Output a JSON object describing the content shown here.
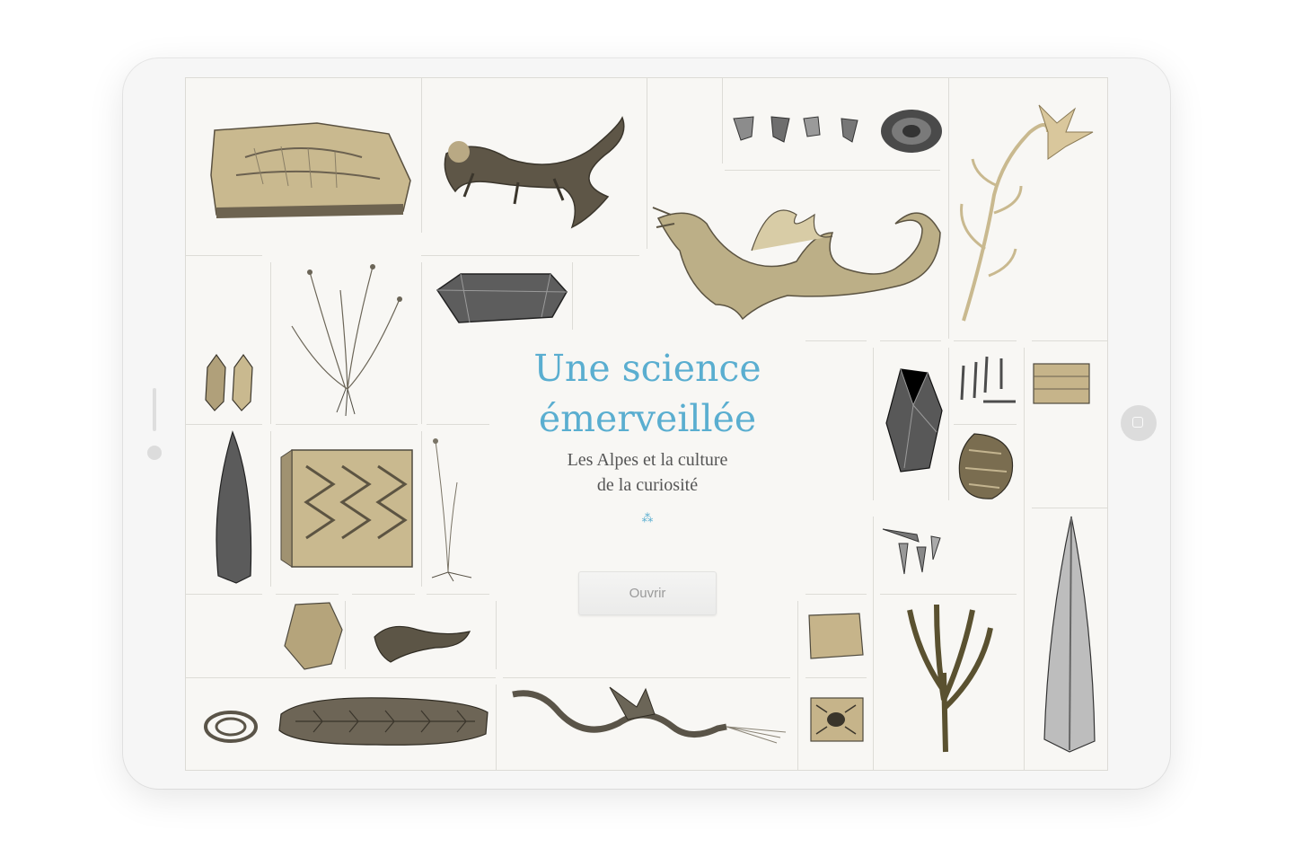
{
  "cover": {
    "title_line1": "Une science",
    "title_line2": "émerveillée",
    "subtitle_line1": "Les Alpes et la culture",
    "subtitle_line2": "de la curiosité",
    "asterism": "⁂",
    "open_button_label": "Ouvrir"
  },
  "colors": {
    "accent": "#5aaed0",
    "engraving_sepia": "#c3b48f",
    "engraving_dark": "#4f4a3e",
    "background": "#f8f7f4"
  },
  "illustrations": [
    "fossil-fish-slab",
    "salamander",
    "crystal-fragments",
    "ammonite",
    "dragon",
    "flowering-plant",
    "grass-plant",
    "quartz-crystal",
    "twin-crystals",
    "belemnite",
    "wood-grain-cube",
    "small-grass",
    "smoky-quartz",
    "nails",
    "wooden-chest",
    "coral-mineral",
    "cone-shells",
    "long-shell",
    "rock-stone",
    "lizard",
    "stone-slab",
    "fern-plant",
    "insect-fossil",
    "coiled-snake",
    "fossil-log",
    "winged-serpent"
  ]
}
